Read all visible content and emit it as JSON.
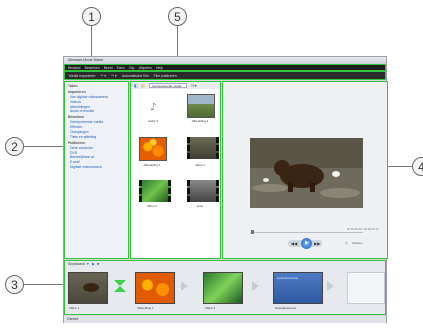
{
  "window": {
    "title": "Windows Movie Maker"
  },
  "menubar": {
    "items": [
      "Bestand",
      "Bewerken",
      "Beeld",
      "Extra",
      "Clip",
      "Afspelen",
      "Help"
    ]
  },
  "toolbar": {
    "items": [
      "Media importeren",
      "Automatische film",
      "Film publiceren"
    ]
  },
  "tasks": {
    "sections": [
      {
        "heading": "Taken",
        "items": []
      },
      {
        "heading": "Importeren",
        "items": [
          "Van digitale videocamera",
          "Video's",
          "Afbeeldingen",
          "Audio of muziek"
        ]
      },
      {
        "heading": "Bewerken",
        "items": [
          "Geïmporteerde media",
          "Effecten",
          "Overgangen",
          "Titels en aftiteling"
        ]
      },
      {
        "heading": "Publiceren",
        "items": [
          "Deze computer",
          "DVD",
          "Beschrijfbare cd",
          "E-mail",
          "Digitale videocamera"
        ]
      }
    ]
  },
  "collection": {
    "selector": "Geïmporteerde media",
    "clips": [
      {
        "label": "Audio 4",
        "kind": "audio"
      },
      {
        "label": "Afbeelding 2",
        "kind": "landscape"
      },
      {
        "label": "Afbeelding 1",
        "kind": "flowers"
      },
      {
        "label": "Video 1",
        "kind": "video"
      },
      {
        "label": "Video 2",
        "kind": "leaves"
      },
      {
        "label": "Lutie",
        "kind": "film"
      }
    ]
  },
  "preview": {
    "time": "00:00:05.46 / 00:00:10.11",
    "split_label": "Splitsen"
  },
  "storyboard": {
    "label": "Storyboard",
    "clips": [
      {
        "label": "Video 1",
        "kind": "bear"
      },
      {
        "label": "Afbeelding 1",
        "kind": "flowers"
      },
      {
        "label": "Video 2",
        "kind": "leaves"
      },
      {
        "label": "Geluidsopname",
        "kind": "blue",
        "overlay": "Geluidsopname"
      },
      {
        "label": "",
        "kind": "empty"
      }
    ]
  },
  "statusbar": {
    "text": "Gereed"
  },
  "callouts": [
    "1",
    "2",
    "3",
    "4",
    "5"
  ],
  "colors": {
    "highlight": "#35c23d",
    "link": "#1f5fb8",
    "menubar": "#1d1d1d"
  }
}
